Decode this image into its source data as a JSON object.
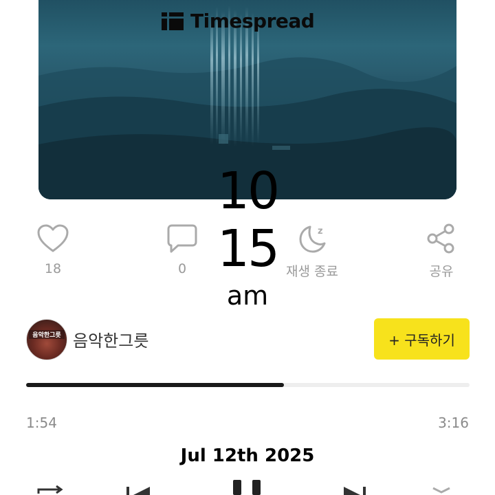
{
  "cover": {
    "brand": "Timespread"
  },
  "clock": {
    "hour": "10",
    "minute": "15",
    "ampm": "am",
    "date": "Jul 12th 2025"
  },
  "actions": {
    "like": {
      "label": "18",
      "icon": "heart-icon"
    },
    "comment": {
      "label": "0",
      "icon": "comment-icon"
    },
    "sleep_timer": {
      "label": "재생 종료",
      "icon": "moon-icon"
    },
    "share": {
      "label": "공유",
      "icon": "share-icon"
    }
  },
  "channel": {
    "name": "음악한그릇",
    "avatar_text": "음악한그릇",
    "subscribe_label": "+ 구독하기"
  },
  "player": {
    "elapsed": "1:54",
    "total": "3:16",
    "progress": 0.582
  },
  "colors": {
    "accent": "#f7e21c",
    "progress_fill": "#1a1a1a",
    "muted_text": "#9a9a9a"
  }
}
